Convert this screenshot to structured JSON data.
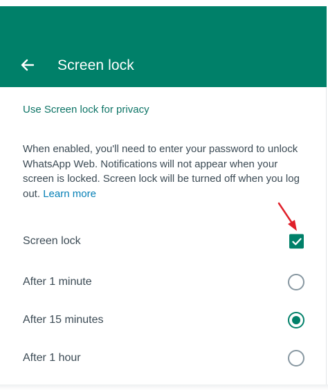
{
  "colors": {
    "header_bg": "#008069",
    "accent": "#008069",
    "section_title": "#0d7466",
    "link": "#027eb5",
    "body_text": "#3b4a54",
    "radio_border": "#8696a0",
    "annotation_arrow": "#e0202a"
  },
  "header": {
    "back_icon": "arrow-left-icon",
    "title": "Screen lock"
  },
  "section": {
    "title": "Use Screen lock for privacy",
    "description": "When enabled, you'll need to enter your password to unlock WhatsApp Web. Notifications will not appear when your screen is locked. Screen lock will be turned off when you log out.",
    "learn_more": "Learn more"
  },
  "settings": {
    "screen_lock": {
      "label": "Screen lock",
      "checked": true
    },
    "timeouts": [
      {
        "label": "After 1 minute",
        "selected": false
      },
      {
        "label": "After 15 minutes",
        "selected": true
      },
      {
        "label": "After 1 hour",
        "selected": false
      }
    ]
  }
}
